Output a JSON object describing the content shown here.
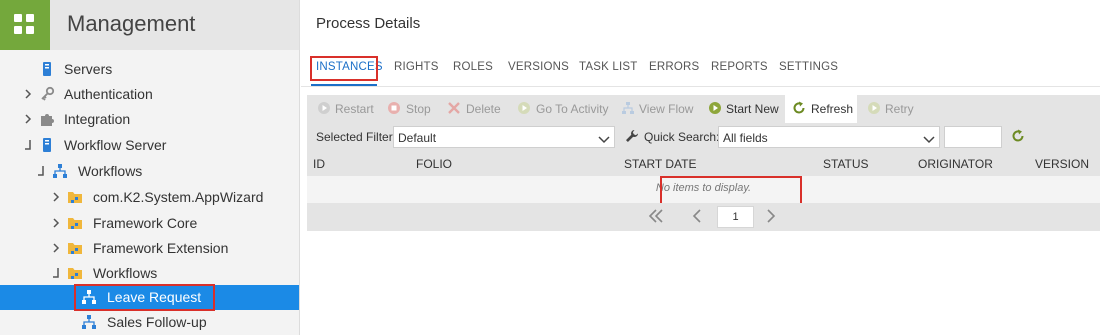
{
  "sidebar": {
    "title": "Management",
    "items": [
      {
        "label": "Servers",
        "icon": "server-icon"
      },
      {
        "label": "Authentication",
        "icon": "key-icon"
      },
      {
        "label": "Integration",
        "icon": "puzzle-icon"
      },
      {
        "label": "Workflow Server",
        "icon": "server-icon"
      },
      {
        "label": "Workflows",
        "icon": "workflow-icon"
      },
      {
        "label": "com.K2.System.AppWizard",
        "icon": "folder-icon"
      },
      {
        "label": "Framework Core",
        "icon": "folder-icon"
      },
      {
        "label": "Framework Extension",
        "icon": "folder-icon"
      },
      {
        "label": "Workflows",
        "icon": "folder-icon"
      },
      {
        "label": "Leave Request",
        "icon": "workflow-icon",
        "selected": true
      },
      {
        "label": "Sales Follow-up",
        "icon": "workflow-icon"
      }
    ]
  },
  "main": {
    "title": "Process Details",
    "tabs": [
      "INSTANCES",
      "RIGHTS",
      "ROLES",
      "VERSIONS",
      "TASK LIST",
      "ERRORS",
      "REPORTS",
      "SETTINGS"
    ],
    "active_tab": "INSTANCES",
    "toolbar": {
      "restart": "Restart",
      "stop": "Stop",
      "delete": "Delete",
      "goto_activity": "Go To Activity",
      "view_flow": "View Flow",
      "start_new": "Start New",
      "refresh": "Refresh",
      "retry": "Retry"
    },
    "filter": {
      "selected_filter_label": "Selected Filter:",
      "selected_filter_value": "Default",
      "quick_search_label": "Quick Search:",
      "quick_search_value": "All fields",
      "search_text": ""
    },
    "table": {
      "columns": [
        "ID",
        "FOLIO",
        "START DATE",
        "STATUS",
        "ORIGINATOR",
        "VERSION"
      ],
      "empty_message": "No items to display."
    },
    "pager": {
      "current_page": "1"
    }
  },
  "colors": {
    "accent_green": "#74a83c",
    "selection_blue": "#1b8ae6",
    "tab_blue": "#1b6fc8",
    "highlight_red": "#d9302a"
  }
}
